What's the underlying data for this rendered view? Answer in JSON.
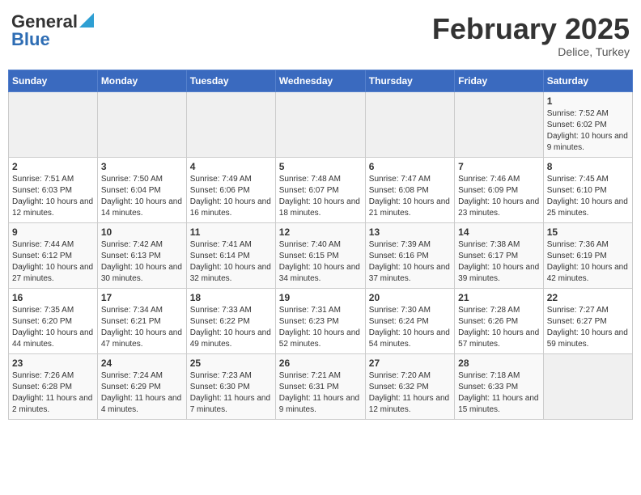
{
  "header": {
    "logo_general": "General",
    "logo_blue": "Blue",
    "month": "February 2025",
    "location": "Delice, Turkey"
  },
  "days_of_week": [
    "Sunday",
    "Monday",
    "Tuesday",
    "Wednesday",
    "Thursday",
    "Friday",
    "Saturday"
  ],
  "weeks": [
    [
      {
        "day": "",
        "info": ""
      },
      {
        "day": "",
        "info": ""
      },
      {
        "day": "",
        "info": ""
      },
      {
        "day": "",
        "info": ""
      },
      {
        "day": "",
        "info": ""
      },
      {
        "day": "",
        "info": ""
      },
      {
        "day": "1",
        "info": "Sunrise: 7:52 AM\nSunset: 6:02 PM\nDaylight: 10 hours and 9 minutes."
      }
    ],
    [
      {
        "day": "2",
        "info": "Sunrise: 7:51 AM\nSunset: 6:03 PM\nDaylight: 10 hours and 12 minutes."
      },
      {
        "day": "3",
        "info": "Sunrise: 7:50 AM\nSunset: 6:04 PM\nDaylight: 10 hours and 14 minutes."
      },
      {
        "day": "4",
        "info": "Sunrise: 7:49 AM\nSunset: 6:06 PM\nDaylight: 10 hours and 16 minutes."
      },
      {
        "day": "5",
        "info": "Sunrise: 7:48 AM\nSunset: 6:07 PM\nDaylight: 10 hours and 18 minutes."
      },
      {
        "day": "6",
        "info": "Sunrise: 7:47 AM\nSunset: 6:08 PM\nDaylight: 10 hours and 21 minutes."
      },
      {
        "day": "7",
        "info": "Sunrise: 7:46 AM\nSunset: 6:09 PM\nDaylight: 10 hours and 23 minutes."
      },
      {
        "day": "8",
        "info": "Sunrise: 7:45 AM\nSunset: 6:10 PM\nDaylight: 10 hours and 25 minutes."
      }
    ],
    [
      {
        "day": "9",
        "info": "Sunrise: 7:44 AM\nSunset: 6:12 PM\nDaylight: 10 hours and 27 minutes."
      },
      {
        "day": "10",
        "info": "Sunrise: 7:42 AM\nSunset: 6:13 PM\nDaylight: 10 hours and 30 minutes."
      },
      {
        "day": "11",
        "info": "Sunrise: 7:41 AM\nSunset: 6:14 PM\nDaylight: 10 hours and 32 minutes."
      },
      {
        "day": "12",
        "info": "Sunrise: 7:40 AM\nSunset: 6:15 PM\nDaylight: 10 hours and 34 minutes."
      },
      {
        "day": "13",
        "info": "Sunrise: 7:39 AM\nSunset: 6:16 PM\nDaylight: 10 hours and 37 minutes."
      },
      {
        "day": "14",
        "info": "Sunrise: 7:38 AM\nSunset: 6:17 PM\nDaylight: 10 hours and 39 minutes."
      },
      {
        "day": "15",
        "info": "Sunrise: 7:36 AM\nSunset: 6:19 PM\nDaylight: 10 hours and 42 minutes."
      }
    ],
    [
      {
        "day": "16",
        "info": "Sunrise: 7:35 AM\nSunset: 6:20 PM\nDaylight: 10 hours and 44 minutes."
      },
      {
        "day": "17",
        "info": "Sunrise: 7:34 AM\nSunset: 6:21 PM\nDaylight: 10 hours and 47 minutes."
      },
      {
        "day": "18",
        "info": "Sunrise: 7:33 AM\nSunset: 6:22 PM\nDaylight: 10 hours and 49 minutes."
      },
      {
        "day": "19",
        "info": "Sunrise: 7:31 AM\nSunset: 6:23 PM\nDaylight: 10 hours and 52 minutes."
      },
      {
        "day": "20",
        "info": "Sunrise: 7:30 AM\nSunset: 6:24 PM\nDaylight: 10 hours and 54 minutes."
      },
      {
        "day": "21",
        "info": "Sunrise: 7:28 AM\nSunset: 6:26 PM\nDaylight: 10 hours and 57 minutes."
      },
      {
        "day": "22",
        "info": "Sunrise: 7:27 AM\nSunset: 6:27 PM\nDaylight: 10 hours and 59 minutes."
      }
    ],
    [
      {
        "day": "23",
        "info": "Sunrise: 7:26 AM\nSunset: 6:28 PM\nDaylight: 11 hours and 2 minutes."
      },
      {
        "day": "24",
        "info": "Sunrise: 7:24 AM\nSunset: 6:29 PM\nDaylight: 11 hours and 4 minutes."
      },
      {
        "day": "25",
        "info": "Sunrise: 7:23 AM\nSunset: 6:30 PM\nDaylight: 11 hours and 7 minutes."
      },
      {
        "day": "26",
        "info": "Sunrise: 7:21 AM\nSunset: 6:31 PM\nDaylight: 11 hours and 9 minutes."
      },
      {
        "day": "27",
        "info": "Sunrise: 7:20 AM\nSunset: 6:32 PM\nDaylight: 11 hours and 12 minutes."
      },
      {
        "day": "28",
        "info": "Sunrise: 7:18 AM\nSunset: 6:33 PM\nDaylight: 11 hours and 15 minutes."
      },
      {
        "day": "",
        "info": ""
      }
    ]
  ]
}
